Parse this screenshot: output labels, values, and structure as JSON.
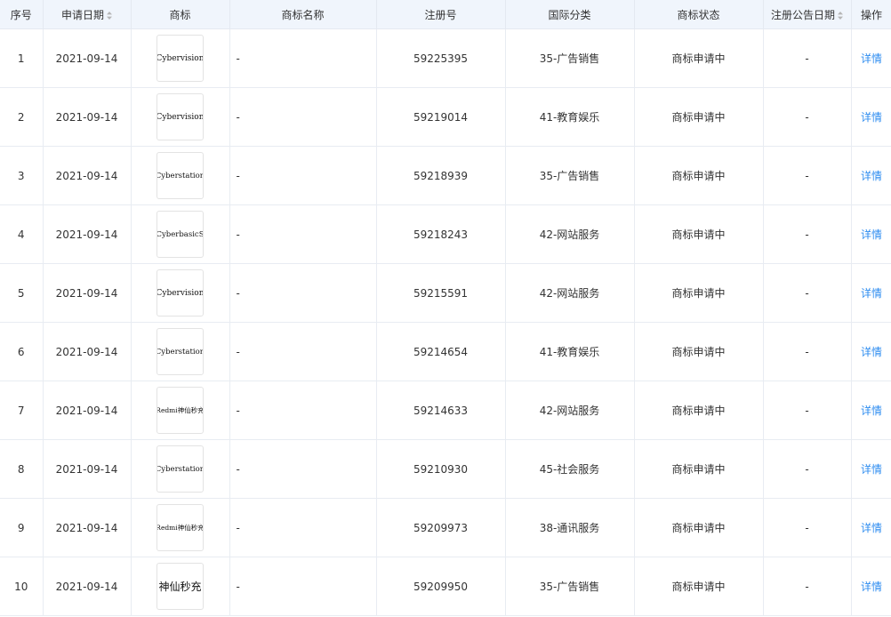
{
  "columns": {
    "index": "序号",
    "apply_date": "申请日期",
    "logo": "商标",
    "name": "商标名称",
    "reg_no": "注册号",
    "intl_class": "国际分类",
    "status": "商标状态",
    "pub_date": "注册公告日期",
    "action": "操作"
  },
  "rows": [
    {
      "index": "1",
      "apply_date": "2021-09-14",
      "logo": "Cybervision",
      "name": "-",
      "reg_no": "59225395",
      "intl_class": "35-广告销售",
      "status": "商标申请中",
      "pub_date": "-",
      "action": "详情"
    },
    {
      "index": "2",
      "apply_date": "2021-09-14",
      "logo": "Cybervision",
      "name": "-",
      "reg_no": "59219014",
      "intl_class": "41-教育娱乐",
      "status": "商标申请中",
      "pub_date": "-",
      "action": "详情"
    },
    {
      "index": "3",
      "apply_date": "2021-09-14",
      "logo": "Cyberstation",
      "name": "-",
      "reg_no": "59218939",
      "intl_class": "35-广告销售",
      "status": "商标申请中",
      "pub_date": "-",
      "action": "详情"
    },
    {
      "index": "4",
      "apply_date": "2021-09-14",
      "logo": "CyberbasicS",
      "name": "-",
      "reg_no": "59218243",
      "intl_class": "42-网站服务",
      "status": "商标申请中",
      "pub_date": "-",
      "action": "详情"
    },
    {
      "index": "5",
      "apply_date": "2021-09-14",
      "logo": "Cybervision",
      "name": "-",
      "reg_no": "59215591",
      "intl_class": "42-网站服务",
      "status": "商标申请中",
      "pub_date": "-",
      "action": "详情"
    },
    {
      "index": "6",
      "apply_date": "2021-09-14",
      "logo": "Cyberstation",
      "name": "-",
      "reg_no": "59214654",
      "intl_class": "41-教育娱乐",
      "status": "商标申请中",
      "pub_date": "-",
      "action": "详情"
    },
    {
      "index": "7",
      "apply_date": "2021-09-14",
      "logo": "Redmi神仙秒充",
      "name": "-",
      "reg_no": "59214633",
      "intl_class": "42-网站服务",
      "status": "商标申请中",
      "pub_date": "-",
      "action": "详情"
    },
    {
      "index": "8",
      "apply_date": "2021-09-14",
      "logo": "Cyberstation",
      "name": "-",
      "reg_no": "59210930",
      "intl_class": "45-社会服务",
      "status": "商标申请中",
      "pub_date": "-",
      "action": "详情"
    },
    {
      "index": "9",
      "apply_date": "2021-09-14",
      "logo": "Redmi神仙秒充",
      "name": "-",
      "reg_no": "59209973",
      "intl_class": "38-通讯服务",
      "status": "商标申请中",
      "pub_date": "-",
      "action": "详情"
    },
    {
      "index": "10",
      "apply_date": "2021-09-14",
      "logo": "神仙秒充",
      "name": "-",
      "reg_no": "59209950",
      "intl_class": "35-广告销售",
      "status": "商标申请中",
      "pub_date": "-",
      "action": "详情"
    }
  ],
  "icons": {
    "sort": "sort-caret-icon"
  },
  "colors": {
    "header_bg": "#f0f5fc",
    "link": "#2d8cf0",
    "border": "#e8ecf2"
  }
}
